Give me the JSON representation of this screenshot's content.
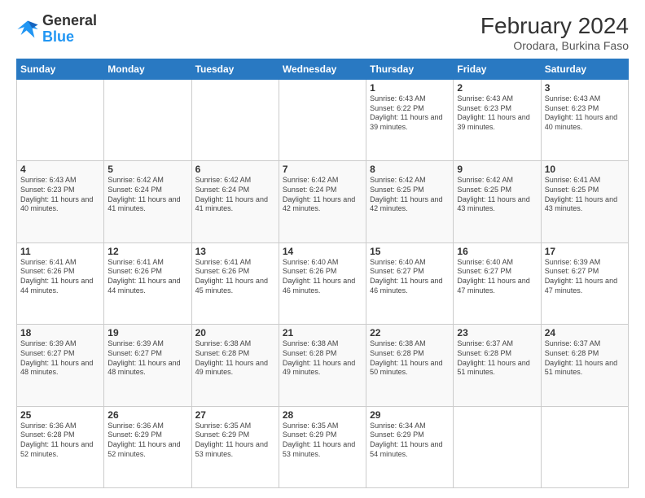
{
  "header": {
    "logo_line1": "General",
    "logo_line2": "Blue",
    "month_year": "February 2024",
    "location": "Orodara, Burkina Faso"
  },
  "days_of_week": [
    "Sunday",
    "Monday",
    "Tuesday",
    "Wednesday",
    "Thursday",
    "Friday",
    "Saturday"
  ],
  "weeks": [
    [
      {
        "day": "",
        "info": ""
      },
      {
        "day": "",
        "info": ""
      },
      {
        "day": "",
        "info": ""
      },
      {
        "day": "",
        "info": ""
      },
      {
        "day": "1",
        "info": "Sunrise: 6:43 AM\nSunset: 6:22 PM\nDaylight: 11 hours and 39 minutes."
      },
      {
        "day": "2",
        "info": "Sunrise: 6:43 AM\nSunset: 6:23 PM\nDaylight: 11 hours and 39 minutes."
      },
      {
        "day": "3",
        "info": "Sunrise: 6:43 AM\nSunset: 6:23 PM\nDaylight: 11 hours and 40 minutes."
      }
    ],
    [
      {
        "day": "4",
        "info": "Sunrise: 6:43 AM\nSunset: 6:23 PM\nDaylight: 11 hours and 40 minutes."
      },
      {
        "day": "5",
        "info": "Sunrise: 6:42 AM\nSunset: 6:24 PM\nDaylight: 11 hours and 41 minutes."
      },
      {
        "day": "6",
        "info": "Sunrise: 6:42 AM\nSunset: 6:24 PM\nDaylight: 11 hours and 41 minutes."
      },
      {
        "day": "7",
        "info": "Sunrise: 6:42 AM\nSunset: 6:24 PM\nDaylight: 11 hours and 42 minutes."
      },
      {
        "day": "8",
        "info": "Sunrise: 6:42 AM\nSunset: 6:25 PM\nDaylight: 11 hours and 42 minutes."
      },
      {
        "day": "9",
        "info": "Sunrise: 6:42 AM\nSunset: 6:25 PM\nDaylight: 11 hours and 43 minutes."
      },
      {
        "day": "10",
        "info": "Sunrise: 6:41 AM\nSunset: 6:25 PM\nDaylight: 11 hours and 43 minutes."
      }
    ],
    [
      {
        "day": "11",
        "info": "Sunrise: 6:41 AM\nSunset: 6:26 PM\nDaylight: 11 hours and 44 minutes."
      },
      {
        "day": "12",
        "info": "Sunrise: 6:41 AM\nSunset: 6:26 PM\nDaylight: 11 hours and 44 minutes."
      },
      {
        "day": "13",
        "info": "Sunrise: 6:41 AM\nSunset: 6:26 PM\nDaylight: 11 hours and 45 minutes."
      },
      {
        "day": "14",
        "info": "Sunrise: 6:40 AM\nSunset: 6:26 PM\nDaylight: 11 hours and 46 minutes."
      },
      {
        "day": "15",
        "info": "Sunrise: 6:40 AM\nSunset: 6:27 PM\nDaylight: 11 hours and 46 minutes."
      },
      {
        "day": "16",
        "info": "Sunrise: 6:40 AM\nSunset: 6:27 PM\nDaylight: 11 hours and 47 minutes."
      },
      {
        "day": "17",
        "info": "Sunrise: 6:39 AM\nSunset: 6:27 PM\nDaylight: 11 hours and 47 minutes."
      }
    ],
    [
      {
        "day": "18",
        "info": "Sunrise: 6:39 AM\nSunset: 6:27 PM\nDaylight: 11 hours and 48 minutes."
      },
      {
        "day": "19",
        "info": "Sunrise: 6:39 AM\nSunset: 6:27 PM\nDaylight: 11 hours and 48 minutes."
      },
      {
        "day": "20",
        "info": "Sunrise: 6:38 AM\nSunset: 6:28 PM\nDaylight: 11 hours and 49 minutes."
      },
      {
        "day": "21",
        "info": "Sunrise: 6:38 AM\nSunset: 6:28 PM\nDaylight: 11 hours and 49 minutes."
      },
      {
        "day": "22",
        "info": "Sunrise: 6:38 AM\nSunset: 6:28 PM\nDaylight: 11 hours and 50 minutes."
      },
      {
        "day": "23",
        "info": "Sunrise: 6:37 AM\nSunset: 6:28 PM\nDaylight: 11 hours and 51 minutes."
      },
      {
        "day": "24",
        "info": "Sunrise: 6:37 AM\nSunset: 6:28 PM\nDaylight: 11 hours and 51 minutes."
      }
    ],
    [
      {
        "day": "25",
        "info": "Sunrise: 6:36 AM\nSunset: 6:28 PM\nDaylight: 11 hours and 52 minutes."
      },
      {
        "day": "26",
        "info": "Sunrise: 6:36 AM\nSunset: 6:29 PM\nDaylight: 11 hours and 52 minutes."
      },
      {
        "day": "27",
        "info": "Sunrise: 6:35 AM\nSunset: 6:29 PM\nDaylight: 11 hours and 53 minutes."
      },
      {
        "day": "28",
        "info": "Sunrise: 6:35 AM\nSunset: 6:29 PM\nDaylight: 11 hours and 53 minutes."
      },
      {
        "day": "29",
        "info": "Sunrise: 6:34 AM\nSunset: 6:29 PM\nDaylight: 11 hours and 54 minutes."
      },
      {
        "day": "",
        "info": ""
      },
      {
        "day": "",
        "info": ""
      }
    ]
  ]
}
